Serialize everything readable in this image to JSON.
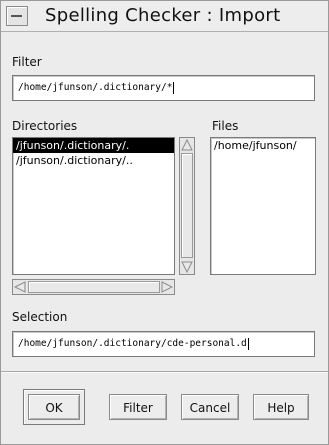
{
  "window": {
    "title": "Spelling Checker : Import"
  },
  "filter": {
    "label": "Filter",
    "value": "/home/jfunson/.dictionary/*"
  },
  "directories": {
    "label": "Directories",
    "items": [
      {
        "label": "/jfunson/.dictionary/.",
        "selected": true
      },
      {
        "label": "/jfunson/.dictionary/..",
        "selected": false
      }
    ]
  },
  "files": {
    "label": "Files",
    "items": [
      {
        "label": "/home/jfunson/"
      }
    ]
  },
  "selection": {
    "label": "Selection",
    "value": "/home/jfunson/.dictionary/cde-personal.d"
  },
  "buttons": {
    "ok": "OK",
    "filter": "Filter",
    "cancel": "Cancel",
    "help": "Help"
  }
}
